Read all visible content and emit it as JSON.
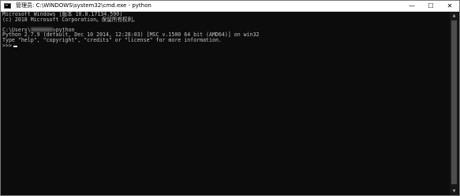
{
  "window": {
    "title": "管理员: C:\\WINDOWS\\system32\\cmd.exe - python",
    "controls": {
      "minimize": "—",
      "maximize": "☐",
      "close": "✕"
    }
  },
  "console": {
    "line1": "Microsoft Windows [版本 10.0.17134.590]",
    "line2": "(c) 2018 Microsoft Corporation。保留所有权利。",
    "line3": "",
    "line4_prefix": "C:\\Users\\",
    "line4_suffix": ">python",
    "line5": "Python 2.7.9 (default, Dec 10 2014, 12:28:03) [MSC v.1500 64 bit (AMD64)] on win32",
    "line6": "Type \"help\", \"copyright\", \"credits\" or \"license\" for more information.",
    "prompt": ">>>"
  },
  "colors": {
    "background": "#0c0c0c",
    "text": "#c0c0c0",
    "titlebar": "#ffffff"
  }
}
